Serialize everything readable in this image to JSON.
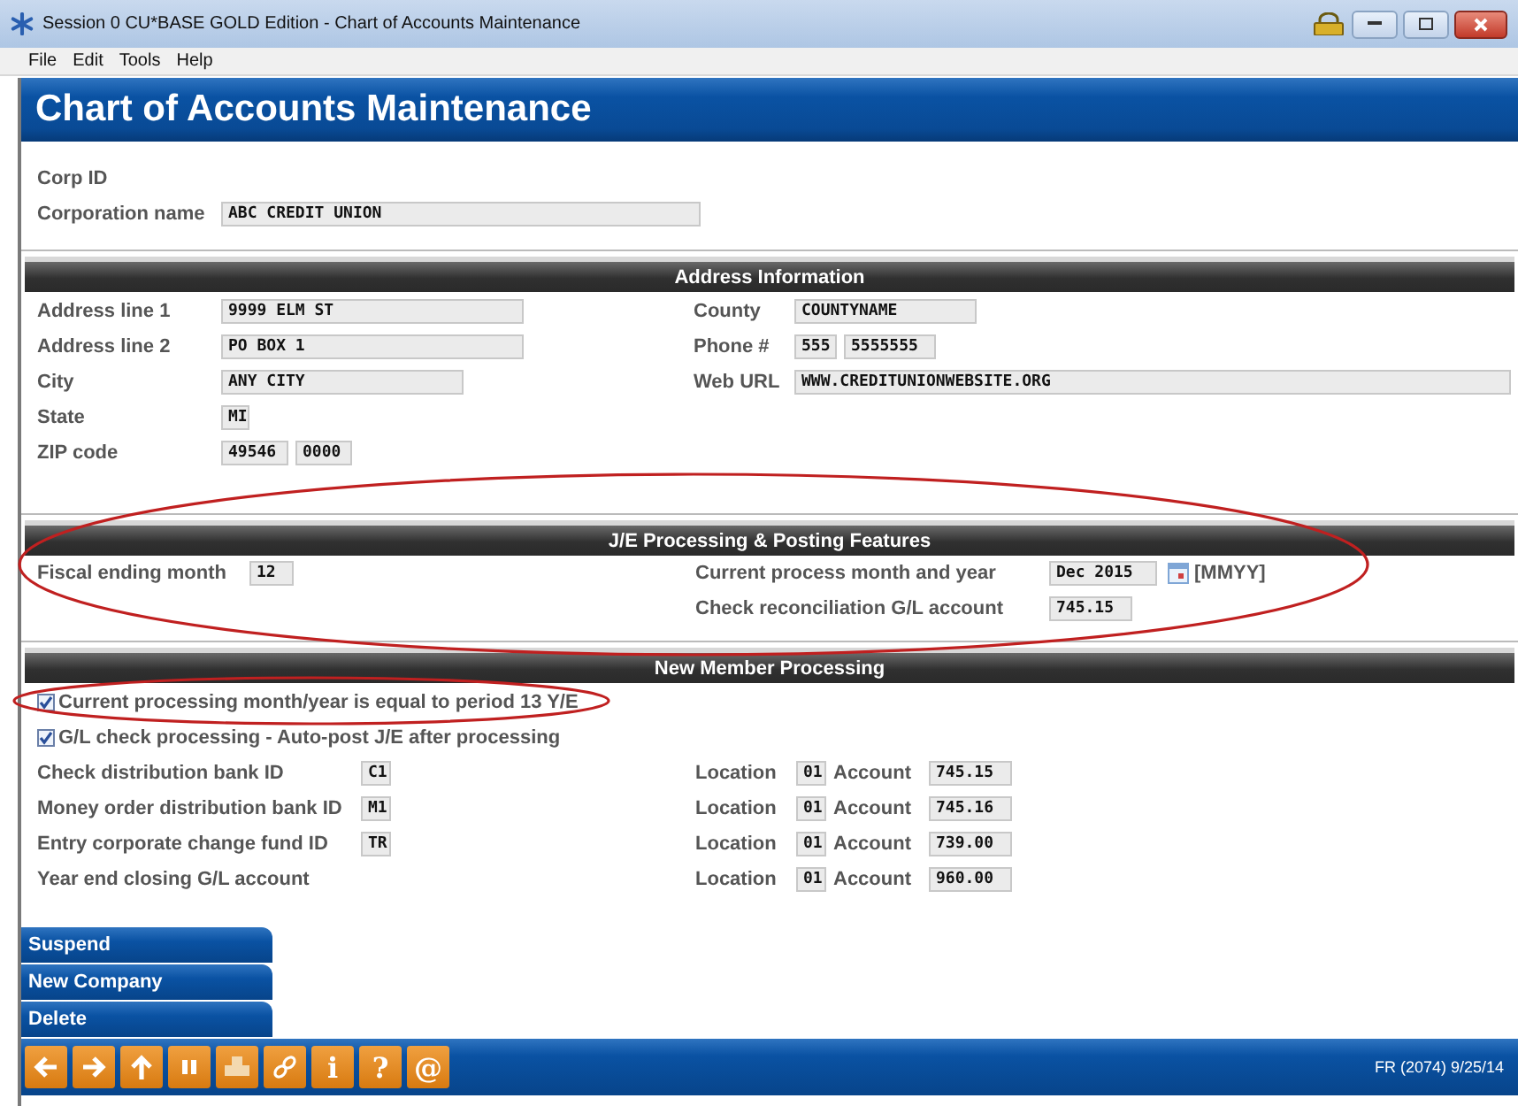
{
  "window": {
    "title": "Session 0 CU*BASE GOLD Edition - Chart of Accounts Maintenance"
  },
  "menu": [
    "File",
    "Edit",
    "Tools",
    "Help"
  ],
  "page_title": "Chart of Accounts Maintenance",
  "corp": [
    {
      "label": "Corp ID"
    },
    {
      "label": "Corporation name",
      "values": [
        "ABC CREDIT UNION"
      ]
    }
  ],
  "address": {
    "heading": "Address Information",
    "left": [
      {
        "label": "Address line 1",
        "values": [
          "9999 ELM ST"
        ]
      },
      {
        "label": "Address line 2",
        "values": [
          "PO BOX 1"
        ]
      },
      {
        "label": "City",
        "values": [
          "ANY CITY"
        ]
      },
      {
        "label": "State",
        "values": [
          "MI"
        ]
      },
      {
        "label": "ZIP code",
        "values": [
          "49546",
          "0000"
        ]
      }
    ],
    "right": [
      {
        "label": "County",
        "values": [
          "COUNTYNAME"
        ]
      },
      {
        "label": "Phone #",
        "values": [
          "555",
          "5555555"
        ]
      },
      {
        "label": "Web URL",
        "values": [
          "WWW.CREDITUNIONWEBSITE.ORG"
        ]
      }
    ]
  },
  "je": {
    "heading": "J/E Processing & Posting Features",
    "left": [
      {
        "label": "Fiscal ending month",
        "values": [
          "12"
        ]
      }
    ],
    "right": [
      {
        "label": "Current process month and year",
        "values": [
          "Dec 2015"
        ],
        "calendar": true,
        "hint": "[MMYY]"
      },
      {
        "label": "Check reconciliation G/L account",
        "values": [
          "745.15"
        ],
        "calendar": false
      }
    ]
  },
  "nmp": {
    "heading": "New Member Processing",
    "checks": [
      {
        "label": "Current processing month/year is equal to period 13 Y/E",
        "checked": true
      },
      {
        "label": "G/L check processing - Auto-post J/E after processing",
        "checked": true
      }
    ],
    "rows": [
      {
        "label": "Check distribution bank ID",
        "id": "C1",
        "location_label": "Location",
        "location": "01",
        "account_label": "Account",
        "account": "745.15"
      },
      {
        "label": "Money order distribution bank ID",
        "id": "M1",
        "location_label": "Location",
        "location": "01",
        "account_label": "Account",
        "account": "745.16"
      },
      {
        "label": "Entry corporate change fund ID",
        "id": "TR",
        "location_label": "Location",
        "location": "01",
        "account_label": "Account",
        "account": "739.00"
      },
      {
        "label": "Year end closing G/L account",
        "location_label": "Location",
        "location": "01",
        "account_label": "Account",
        "account": "960.00"
      }
    ]
  },
  "actions": [
    "Suspend",
    "New Company",
    "Delete"
  ],
  "toolbar": [
    {
      "kind": "arrow-left"
    },
    {
      "kind": "arrow-right"
    },
    {
      "kind": "arrow-up"
    },
    {
      "kind": "pause"
    },
    {
      "kind": "printer"
    },
    {
      "kind": "link"
    },
    {
      "kind": "glyph",
      "glyph": "i"
    },
    {
      "kind": "glyph",
      "glyph": "?"
    },
    {
      "kind": "glyph",
      "glyph": "@"
    }
  ],
  "status": "FR (2074) 9/25/14"
}
